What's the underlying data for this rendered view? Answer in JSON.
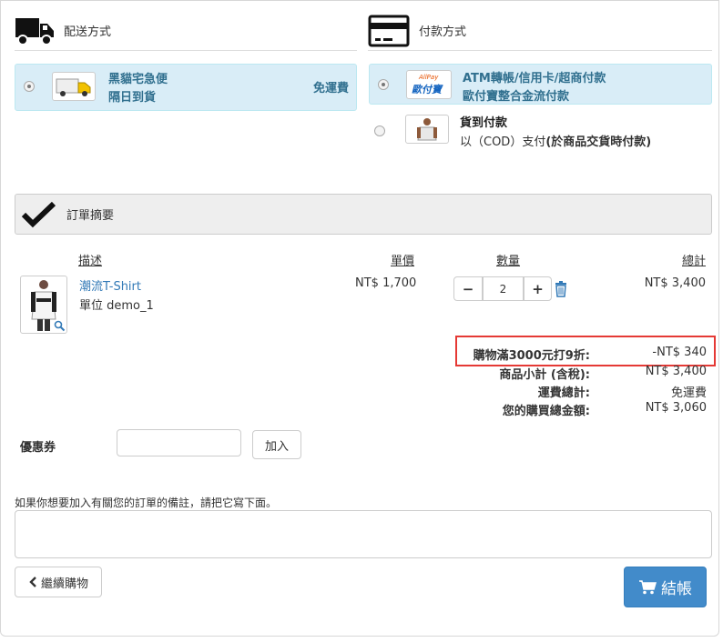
{
  "shipping": {
    "header": "配送方式",
    "option": {
      "line1": "黑貓宅急便",
      "line2": "隔日到貨",
      "price": "免運費"
    }
  },
  "payment": {
    "header": "付款方式",
    "options": [
      {
        "line1": "ATM轉帳/信用卡/超商付款",
        "line2": "歐付寶整合金流付款",
        "logo_text": "歐付寶",
        "logo_small": "AllPay"
      },
      {
        "line1": "貨到付款",
        "line2_prefix": "以（COD）支付",
        "line2_bold": "(於商品交貨時付款)"
      }
    ]
  },
  "summary_panel": {
    "title": "訂單摘要"
  },
  "table": {
    "headers": {
      "desc": "描述",
      "price": "單價",
      "qty": "數量",
      "total": "總計"
    },
    "item": {
      "name": "潮流T-Shirt",
      "unit": "單位 demo_1",
      "price": "NT$ 1,700",
      "qty": "2",
      "total": "NT$ 3,400"
    }
  },
  "totals": {
    "discount_label": "購物滿3000元打9折:",
    "discount_value": "-NT$ 340",
    "subtotal_label": "商品小計 (含稅):",
    "subtotal_value": "NT$ 3,400",
    "shipping_label": "運費總計:",
    "shipping_value": "免運費",
    "grand_label": "您的購買總金額:",
    "grand_value": "NT$ 3,060"
  },
  "coupon": {
    "label": "優惠券",
    "button": "加入",
    "value": ""
  },
  "note": {
    "label": "如果你想要加入有關您的訂單的備註，請把它寫下面。",
    "value": ""
  },
  "actions": {
    "continue": "繼續購物",
    "checkout": "結帳"
  },
  "colors": {
    "accent": "#337ab7",
    "selected_bg": "#d9edf7",
    "highlight": "#e53935",
    "checkout_bg": "#428bca"
  }
}
